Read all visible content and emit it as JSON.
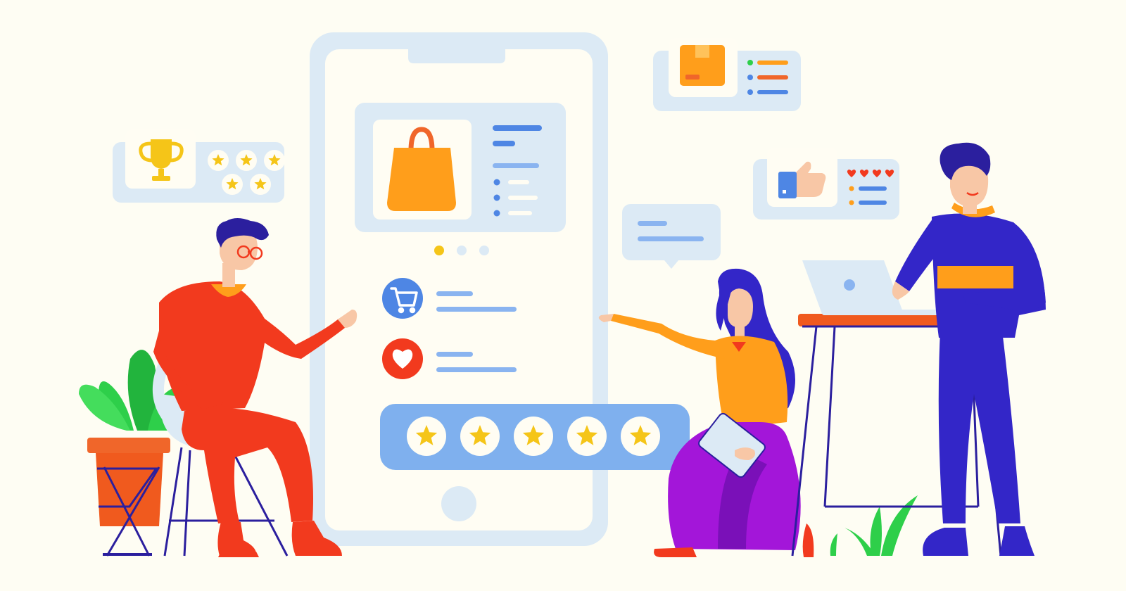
{
  "scene": "illustration",
  "colors": {
    "background": "#FEFDF3",
    "panel": "#DCEAF5",
    "phone_frame": "#DCEAF5",
    "phone_screen": "#FFFDF3",
    "accent_blue": "#4E86E4",
    "light_blue": "#8AB4F0",
    "bar_blue": "#7FB0EE",
    "gold": "#F5C518",
    "orange": "#FF9E1B",
    "red": "#F23A1E",
    "purple": "#A316D9",
    "navy": "#2B1F9E",
    "indigo": "#3326C8",
    "green": "#2ECF4A"
  },
  "icons": {
    "achievement_card": "trophy-icon",
    "package_card": "package-icon",
    "like_card": "thumbs-up-icon",
    "phone_product": "shopping-bag-icon",
    "cart_row": "shopping-cart-icon",
    "favorite_row": "heart-icon",
    "rating": "star-icon",
    "laptop": "laptop-icon"
  },
  "rating": {
    "stars_filled": 5,
    "stars_total": 5
  },
  "achievement_card": {
    "stars_shown": 5
  },
  "like_card": {
    "hearts_shown": 4
  },
  "carousel": {
    "dots_total": 3,
    "active_index": 0
  }
}
